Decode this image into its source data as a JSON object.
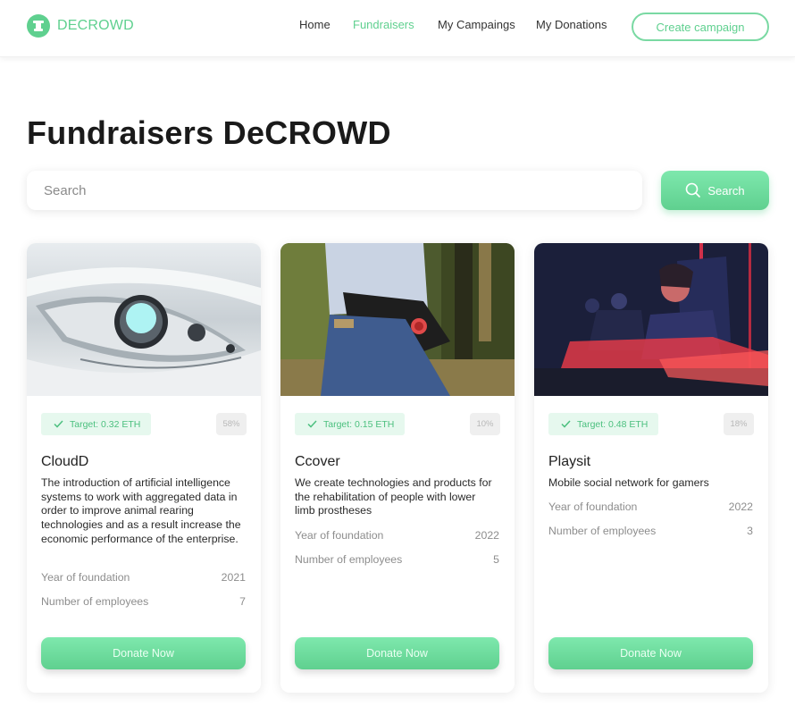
{
  "header": {
    "logo_text": "DECROWD",
    "nav": [
      {
        "label": "Home",
        "active": false
      },
      {
        "label": "Fundraisers",
        "active": true
      },
      {
        "label": "My Campaings",
        "active": false
      },
      {
        "label": "My Donations",
        "active": false
      }
    ],
    "cta_label": "Create campaign"
  },
  "page": {
    "title": "Fundraisers DeCROWD"
  },
  "search": {
    "placeholder": "Search",
    "value": "",
    "button_label": "Search",
    "button_icon": "search-icon"
  },
  "colors": {
    "accent": "#5fd08f",
    "accent_light": "#e6f8ee",
    "badge_gray": "#efefef"
  },
  "stat_labels": {
    "year": "Year of foundation",
    "employees": "Number of employees"
  },
  "cards": [
    {
      "image": "robotic-eye-photo",
      "target": "Target: 0.32 ETH",
      "progress": "58%",
      "title": "CloudD",
      "description": "The introduction of artificial intelligence systems to work with aggregated data in order to improve animal rearing technologies and as a result increase the economic performance of the enterprise.",
      "year_of_foundation": "2021",
      "employees": "7",
      "button_label": "Donate Now"
    },
    {
      "image": "prosthesis-person-forest-photo",
      "target": "Target: 0.15 ETH",
      "progress": "10%",
      "title": "Ccover",
      "description": "We create technologies and products for the rehabilitation of people with lower limb prostheses",
      "year_of_foundation": "2022",
      "employees": "5",
      "button_label": "Donate Now"
    },
    {
      "image": "gamers-playing-photo",
      "target": "Target: 0.48 ETH",
      "progress": "18%",
      "title": "Playsit",
      "description": "Mobile social network for gamers",
      "year_of_foundation": "2022",
      "employees": "3",
      "button_label": "Donate Now"
    }
  ]
}
